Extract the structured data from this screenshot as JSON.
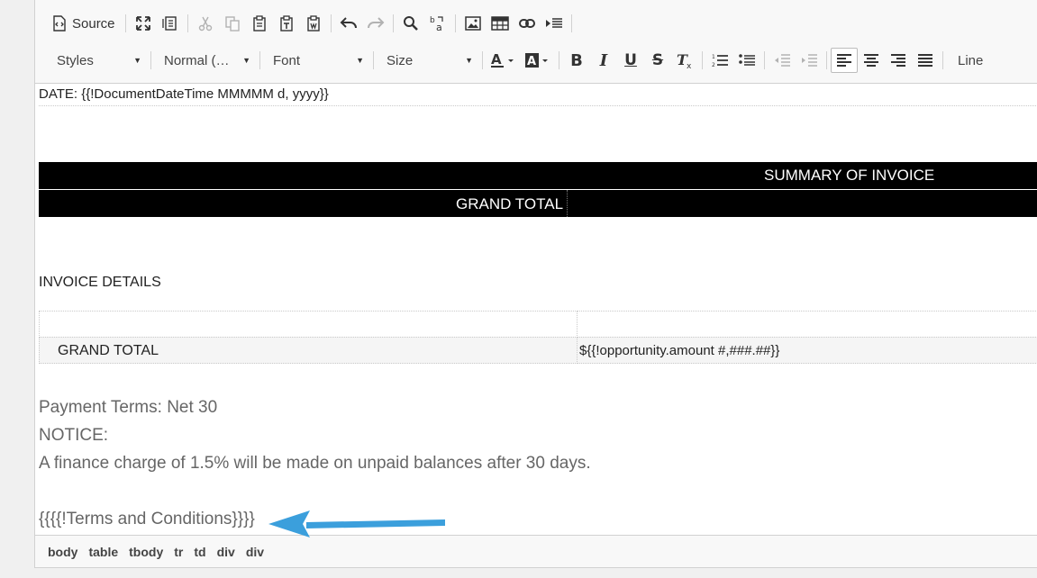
{
  "toolbar": {
    "source_label": "Source",
    "styles_label": "Styles",
    "format_label": "Normal (…",
    "font_label": "Font",
    "size_label": "Size",
    "line_label": "Line"
  },
  "document": {
    "date_line": "DATE: {{!DocumentDateTime MMMMM d, yyyy}}",
    "summary_header": "SUMMARY OF INVOICE",
    "summary_total_label": "GRAND TOTAL",
    "invoice_details_heading": "INVOICE DETAILS",
    "details_total_label": "GRAND TOTAL",
    "details_total_value": "${{!opportunity.amount #,###.##}}",
    "payment_terms": "Payment Terms: Net 30",
    "notice_label": "NOTICE:",
    "finance_charge": "A finance charge of 1.5% will be made on unpaid balances after 30 days.",
    "terms_placeholder": "{{{{!Terms and Conditions}}}}"
  },
  "statusbar": {
    "path": [
      "body",
      "table",
      "tbody",
      "tr",
      "td",
      "div",
      "div"
    ]
  },
  "colors": {
    "arrow": "#3b9fdc",
    "header_band": "#000000"
  }
}
